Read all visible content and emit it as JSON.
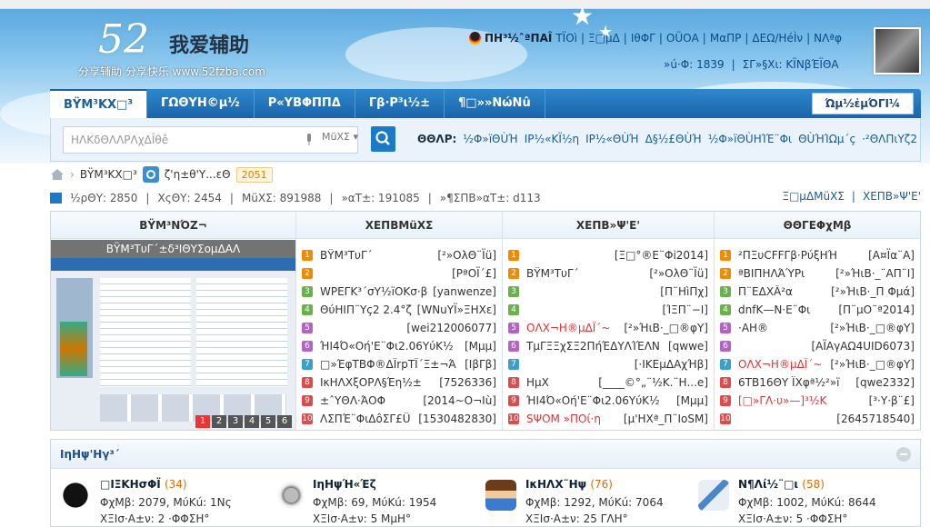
{
  "header": {
    "logo_number": "52",
    "logo_name": "我爱辅助",
    "logo_sub": "分享辅助  分享快乐  www.52fzba.com",
    "user": {
      "name": "ΠΗ³½ˆªΠΑÎ",
      "items": [
        "ΤÏΟì",
        "Ξ□μΔ",
        "ΙθΦΓ",
        "ΟÜΟΑ",
        "ΜαΠΡ",
        "ΔΕΩ/ΗéÌν",
        "ΝΛªφ"
      ],
      "row2": [
        "»ú·Φ: 1839",
        "ΣΓ»§Χι: ΚÏΝβΈÏΘΑ"
      ]
    }
  },
  "nav": {
    "tabs": [
      "ΒŸΜ³ΚΧ□³",
      "ΓΩΘΥΗ©μ½",
      "Ρ«ΥΒΦΠΠΔ",
      "Γβ·Ρ³ι½±",
      "¶□»»ΝώΝû"
    ],
    "right": "Ώμ½ἐμΌΓΙ¼"
  },
  "search": {
    "placeholder": "ΗΛΚδΘΛΛΡΛχΔÎθê",
    "scope": "ΜüΧΣ",
    "hot_label": "ΘΘΛΡ:",
    "hot": [
      "½Φ»ïΘÙΉ",
      "ΙΡ½«ΚÏ½η",
      "ΙΡ½«ΘÙΉ",
      "Δ§½£ΘÙΉ",
      "½Φ»ïΘÙΗΊΈ¨Φι",
      "ΘÙΉΊΩμ´ç",
      "·²ΘΛΠιΥζ2"
    ]
  },
  "crumb": {
    "home": "ΒŸΜ³ΚΧ□³",
    "section": "ζ'η±θ'Υ...εΘ",
    "count": "2051"
  },
  "stats": {
    "items": [
      "½ρΘΥ: 2850",
      "ΧςΘΥ: 2454",
      "ΜüΧΣ: 891988",
      "»αΤ±: 191085",
      "»¶ΣΠΒ»αΤ±: d113"
    ],
    "right": [
      "Ξ□μΔΜüΧΣ",
      "ΧΕΠΒ»Ψ'Ε'"
    ]
  },
  "board": {
    "col1": {
      "title": "ΒŸΜ³ΝΌΖ¬",
      "caption": "ΒŸΜ³ΤυΓ´±δ³ΙΘΥΣομΔΑΛ",
      "pages": [
        "1",
        "2",
        "3",
        "4",
        "5",
        "6"
      ]
    },
    "col2": {
      "title": "ΧΕΠΒΜüΧΣ",
      "rows": [
        {
          "t": "ΒŸΜ³ΤυΓ´",
          "a": "[²»ΟλΘ¨Ϊü]"
        },
        {
          "t": "",
          "a": "[ΡªΟÏ´£]"
        },
        {
          "t": "WPΕΓΚ³´σΥ½ïΟΚσ·β",
          "a": "[yanwenze]"
        },
        {
          "t": "ΘύΗΙΠ¨Υç2 2.4°ζ",
          "a": "[WΝuΥÏ»ΞΗΧε]"
        },
        {
          "t": "",
          "a": "[wei212006077]"
        },
        {
          "t": "ΉΙ4Ό«Οή'Ε¨Φι2.06ΥύΚ½",
          "a": "[Μμμ]"
        },
        {
          "t": "□»ΈφΤΒΦ®ΔÏrpΤÏ´Ξ±¬Ά",
          "a": "[ΙβΓβ]"
        },
        {
          "t": "ΙκΗΛΧξΟΡΛ§Έη½±",
          "a": "[7526336]"
        },
        {
          "t": "±ˆΥΘΛ·ΆΟΦ",
          "a": "[2014~Ο¬Ιù]"
        },
        {
          "t": "ΛΣΠΈ¨ΦιΔôΣΓ£Ü",
          "a": "[1530482830]"
        }
      ]
    },
    "col3": {
      "title": "ΧΕΠΒ»Ψ'Ε'",
      "rows": [
        {
          "t": "",
          "a": "[Ξ□°®Ε¨Φi2014]"
        },
        {
          "t": "ΒŸΜ³ΤυΓ´",
          "a": "[²»ΟλΘ¨Ϊü]"
        },
        {
          "t": "",
          "a": "[Π¨ΗìΠχ]"
        },
        {
          "t": "",
          "a": "[ΊΞΠ¨−Ι]"
        },
        {
          "t": "ΟΛΧ¬Η®μΔÏ´~",
          "a": "[²»ΉιΒ·_□®φΥ]",
          "red": true
        },
        {
          "t": "ΤμΓΞΞχΣΞ2ΠήΈΔΥΛΊΈΛΝ",
          "a": "[qwwe]"
        },
        {
          "t": "",
          "a": "[·ΙΚΕμΔΑχΉβ]"
        },
        {
          "t": "ΗμΧ",
          "a": "[____©°„¨½Κ.¨Η...e]"
        },
        {
          "t": "ΉΙ4Ό«Οή'Ε¨Φι2.06ΥύΚ½",
          "a": "[Μμμ]"
        },
        {
          "t": "SΨΟΜ »ΠΟί·η",
          "a": "[μ'ΗΧª_Π¨ΙοSΜ]",
          "red": true
        }
      ]
    },
    "col4": {
      "title": "ΘΘΓΕΦχΜβ",
      "rows": [
        {
          "t": "²ΠΞυCFFΓβ·ΡύξΗΉ",
          "a": "[Α¤Ïα¨Α]"
        },
        {
          "t": "ªΒΙΠΗΛΆΎΡι",
          "a": "[²»ΉιΒ·_¨ΑΠ¨Ι]"
        },
        {
          "t": "Π¨ΕΔΧÂ²α",
          "a": "[²»ΉιΒ·_Π Φμά]"
        },
        {
          "t": "dnfΚ—Ν·Ε¨Φι",
          "a": "[Π¨μΟ¨ª2014]"
        },
        {
          "t": "·ΑΗ®",
          "a": "[²»ΉιΒ·_□®φΥ]"
        },
        {
          "t": "",
          "a": "[ΑΪΑγΑΩ4UID6073]"
        },
        {
          "t": "ΟΛΧ¬Η®μΔÏ´~",
          "a": "[²»ΉιΒ·_□®φΥ]",
          "red": true
        },
        {
          "t": "6ΤΒ16ΘΥ ΪΧφª½²»ï",
          "a": "[qwe2332]"
        },
        {
          "t": "[□»ΓΛ·υ»—]³½Κ",
          "a": "[³·Υ·β¨£]",
          "red": true
        },
        {
          "t": "",
          "a": "[2645718540]"
        }
      ]
    }
  },
  "forums": {
    "title": "ΙηΗψ'Ηγ³´",
    "items": [
      {
        "name": "□ΙΞΚΗσΦÏ",
        "count": "(34)",
        "line1": "ΦχΜβ: 2079, ΜύΚú: 1Νς",
        "line2": "ΧΞΙσ·Α±ν: 2 ·ΦΦΣΗ°",
        "icon": "black-dust-icon"
      },
      {
        "name": "ΙηΗψΉ«Έζ",
        "count": "",
        "line1": "ΦχΜβ: 69, ΜύΚú: 1954",
        "line2": "ΧΞΙσ·Α±ν: 5 ΜμΗ°",
        "icon": "speaker-icon"
      },
      {
        "name": "ΙκΗΛΧ¨Ηψ",
        "count": "(76)",
        "line1": "ΦχΜβ: 1292, ΜύΚú: 7064",
        "line2": "ΧΞΙσ·Α±ν: 25 ΓΛΗ°",
        "icon": "student-icon"
      },
      {
        "name": "Ν¶Λί½¨□ι",
        "count": "(58)",
        "line1": "ΦχΜβ: 1002, ΜύΚú: 8644",
        "line2": "ΧΞΙσ·Α±ν: 5 ·ΦΦΣΗ°",
        "icon": "plane-icon"
      }
    ]
  },
  "colors": {
    "nav": "#1a64aa",
    "accent": "#e26b00",
    "link": "#1b5a94"
  }
}
